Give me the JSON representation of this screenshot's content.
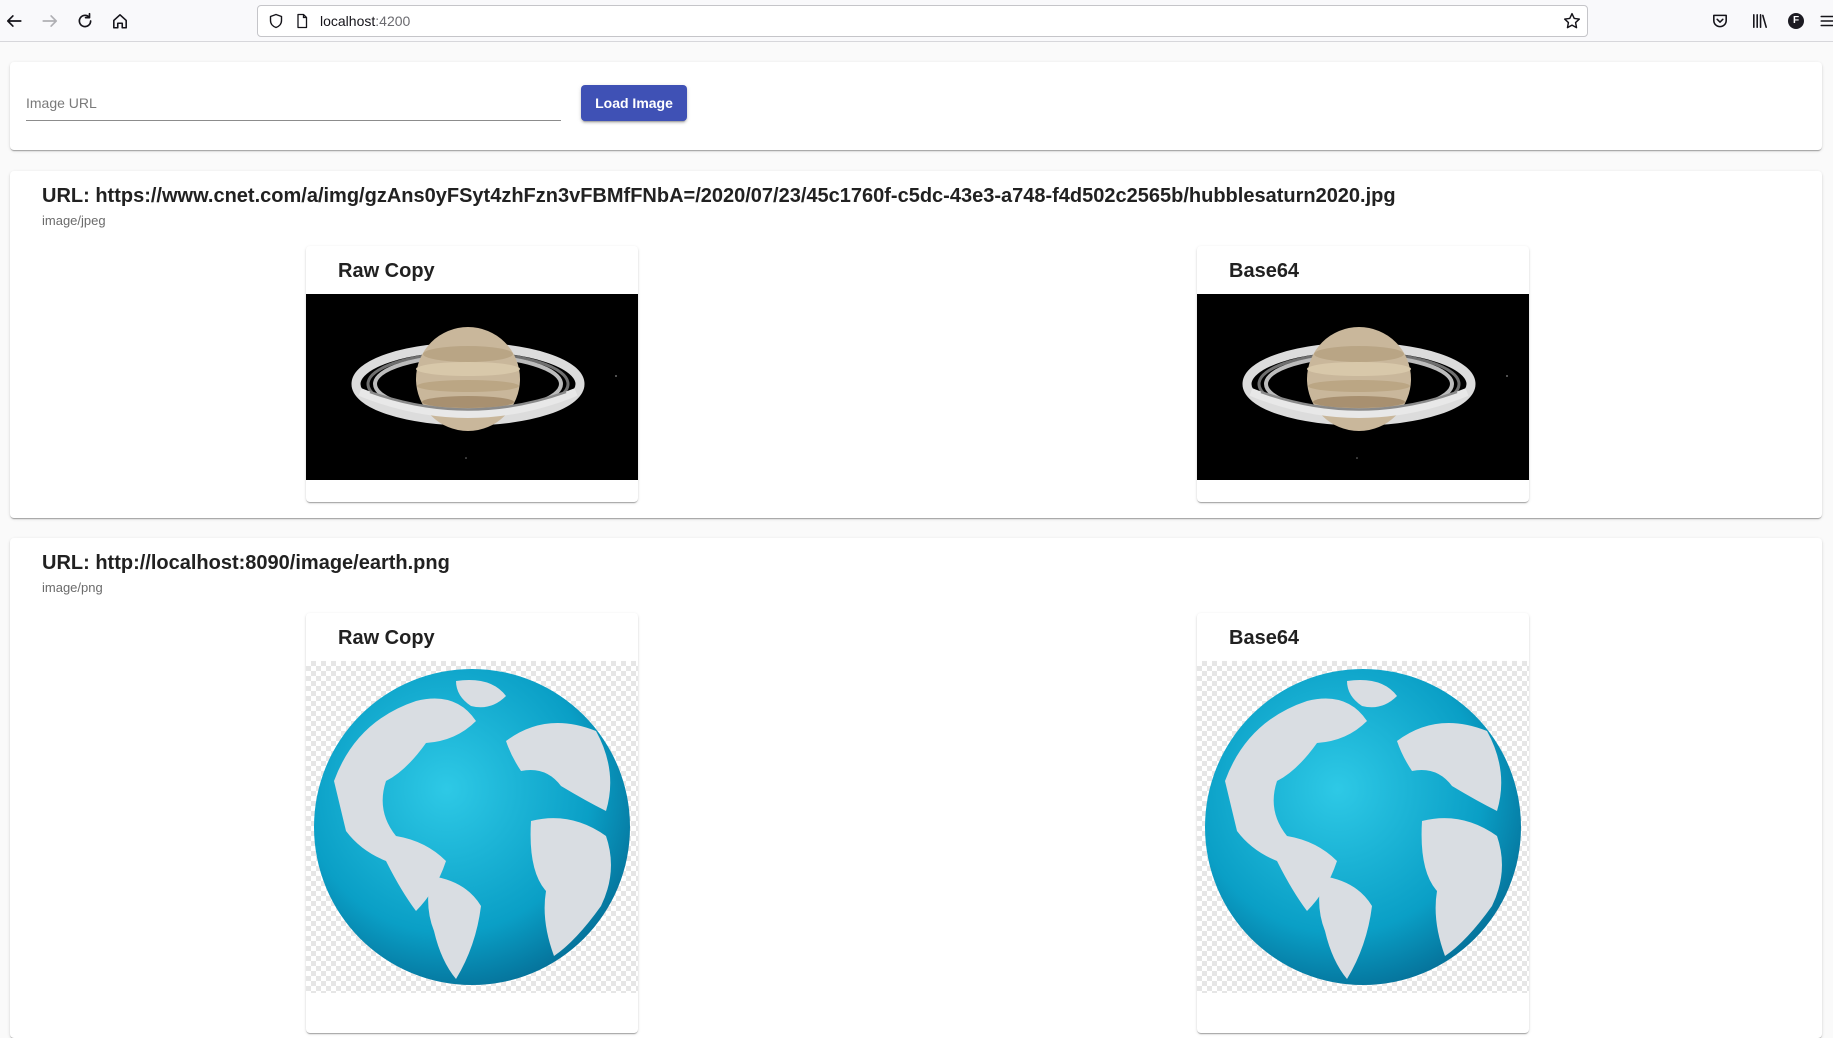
{
  "browser": {
    "url_host": "localhost",
    "url_port": ":4200",
    "profile_initial": "F"
  },
  "form": {
    "image_url_placeholder": "Image URL",
    "image_url_value": "",
    "load_button_label": "Load Image"
  },
  "results": [
    {
      "url_label": "URL: https://www.cnet.com/a/img/gzAns0yFSyt4zhFzn3vFBMfFNbA=/2020/07/23/45c1760f-c5dc-43e3-a748-f4d502c2565b/hubblesaturn2020.jpg",
      "mime_type": "image/jpeg",
      "raw_title": "Raw Copy",
      "base64_title": "Base64",
      "image_subject": "saturn"
    },
    {
      "url_label": "URL: http://localhost:8090/image/earth.png",
      "mime_type": "image/png",
      "raw_title": "Raw Copy",
      "base64_title": "Base64",
      "image_subject": "earth"
    }
  ],
  "colors": {
    "primary_button": "#3f51b5",
    "ocean": "#0a9fc6",
    "land": "#d9dde2"
  }
}
